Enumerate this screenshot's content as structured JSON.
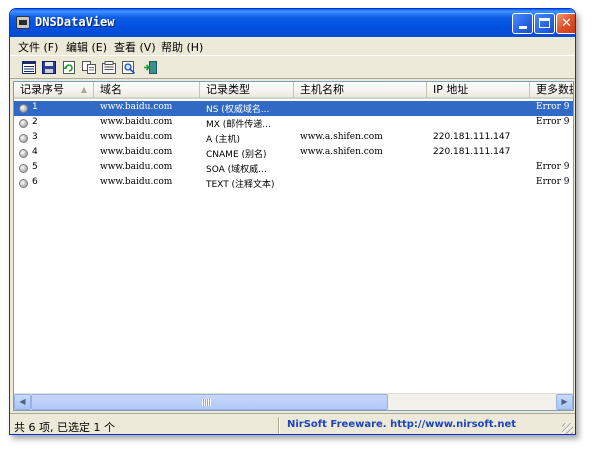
{
  "window": {
    "title": "DNSDataView"
  },
  "menu": [
    {
      "label": "文件 (F)"
    },
    {
      "label": "编辑 (E)"
    },
    {
      "label": "查看 (V)"
    },
    {
      "label": "帮助 (H)"
    }
  ],
  "toolbar_icons": [
    "html-report-icon",
    "save-icon",
    "refresh-icon",
    "copy-icon",
    "properties-icon",
    "find-icon",
    "exit-icon"
  ],
  "table": {
    "columns": [
      "记录序号",
      "域名",
      "记录类型",
      "主机名称",
      "IP 地址",
      "更多数据"
    ],
    "rows": [
      {
        "id": "1",
        "domain": "www.baidu.com",
        "type": "NS (权威域名...",
        "host": "",
        "ip": "",
        "more": "Error 9"
      },
      {
        "id": "2",
        "domain": "www.baidu.com",
        "type": "MX (邮件传递...",
        "host": "",
        "ip": "",
        "more": "Error 9"
      },
      {
        "id": "3",
        "domain": "www.baidu.com",
        "type": "A (主机)",
        "host": "www.a.shifen.com",
        "ip": "220.181.111.147",
        "more": ""
      },
      {
        "id": "4",
        "domain": "www.baidu.com",
        "type": "CNAME (别名)",
        "host": "www.a.shifen.com",
        "ip": "220.181.111.147",
        "more": ""
      },
      {
        "id": "5",
        "domain": "www.baidu.com",
        "type": "SOA (域权威...",
        "host": "",
        "ip": "",
        "more": "Error 9"
      },
      {
        "id": "6",
        "domain": "www.baidu.com",
        "type": "TEXT (注释文本)",
        "host": "",
        "ip": "",
        "more": "Error 9"
      }
    ],
    "selected_row": "1"
  },
  "status": {
    "summary": "共 6 项, 已选定 1 个",
    "credit": "NirSoft Freeware.  http://www.nirsoft.net"
  },
  "colors": {
    "selection": "#316ac5",
    "titlebar": "#0054e3",
    "credit_link": "#1c44c4"
  }
}
